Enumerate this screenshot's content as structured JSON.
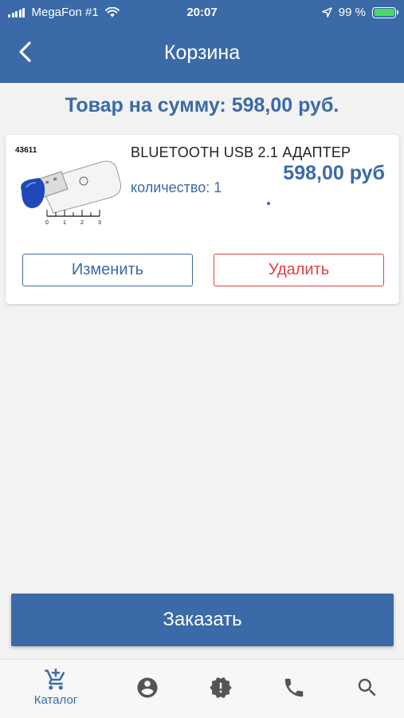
{
  "status_bar": {
    "carrier": "MegaFon #1",
    "time": "20:07",
    "battery": "99 %"
  },
  "nav": {
    "title": "Корзина",
    "back_icon": "chevron-left-icon"
  },
  "total_text": "Товар на сумму: 598,00 руб.",
  "cart_item": {
    "image_code": "43611",
    "image_scale_labels": [
      "0",
      "1",
      "2",
      "3"
    ],
    "name": "BLUETOOTH USB 2.1 АДАПТЕР",
    "quantity_label": "количество: 1",
    "price": "598,00 руб",
    "edit_label": "Изменить",
    "delete_label": "Удалить"
  },
  "order_button": "Заказать",
  "tabbar": {
    "tabs": [
      {
        "icon": "cart-add-icon",
        "label": "Каталог",
        "active": true
      },
      {
        "icon": "account-icon",
        "label": "",
        "active": false
      },
      {
        "icon": "alert-badge-icon",
        "label": "",
        "active": false
      },
      {
        "icon": "phone-icon",
        "label": "",
        "active": false
      },
      {
        "icon": "search-icon",
        "label": "",
        "active": false
      }
    ]
  },
  "colors": {
    "primary": "#3a6aa8",
    "danger": "#e04040",
    "battery": "#4cd964",
    "icon_gray": "#555555"
  }
}
